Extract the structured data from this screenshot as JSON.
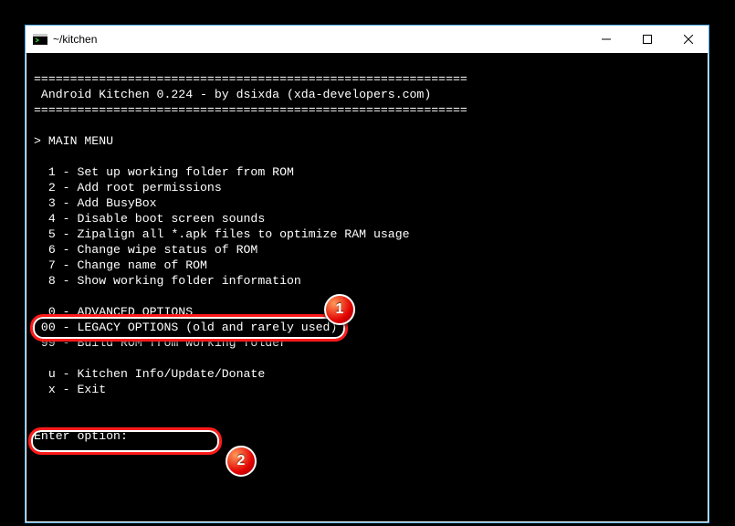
{
  "window": {
    "title": "~/kitchen"
  },
  "terminal": {
    "divider": "============================================================",
    "header": " Android Kitchen 0.224 - by dsixda (xda-developers.com)",
    "menu_title": "> MAIN MENU",
    "items": {
      "i1": "  1 - Set up working folder from ROM",
      "i2": "  2 - Add root permissions",
      "i3": "  3 - Add BusyBox",
      "i4": "  4 - Disable boot screen sounds",
      "i5": "  5 - Zipalign all *.apk files to optimize RAM usage",
      "i6": "  6 - Change wipe status of ROM",
      "i7": "  7 - Change name of ROM",
      "i8": "  8 - Show working folder information",
      "i0": "  0 - ADVANCED OPTIONS",
      "i00": " 00 - LEGACY OPTIONS (old and rarely used)",
      "i99": " 99 - Build ROM from working folder",
      "iu": "  u - Kitchen Info/Update/Donate",
      "ix": "  x - Exit"
    },
    "prompt": "Enter option:"
  },
  "annotations": {
    "badge1": "1",
    "badge2": "2"
  }
}
